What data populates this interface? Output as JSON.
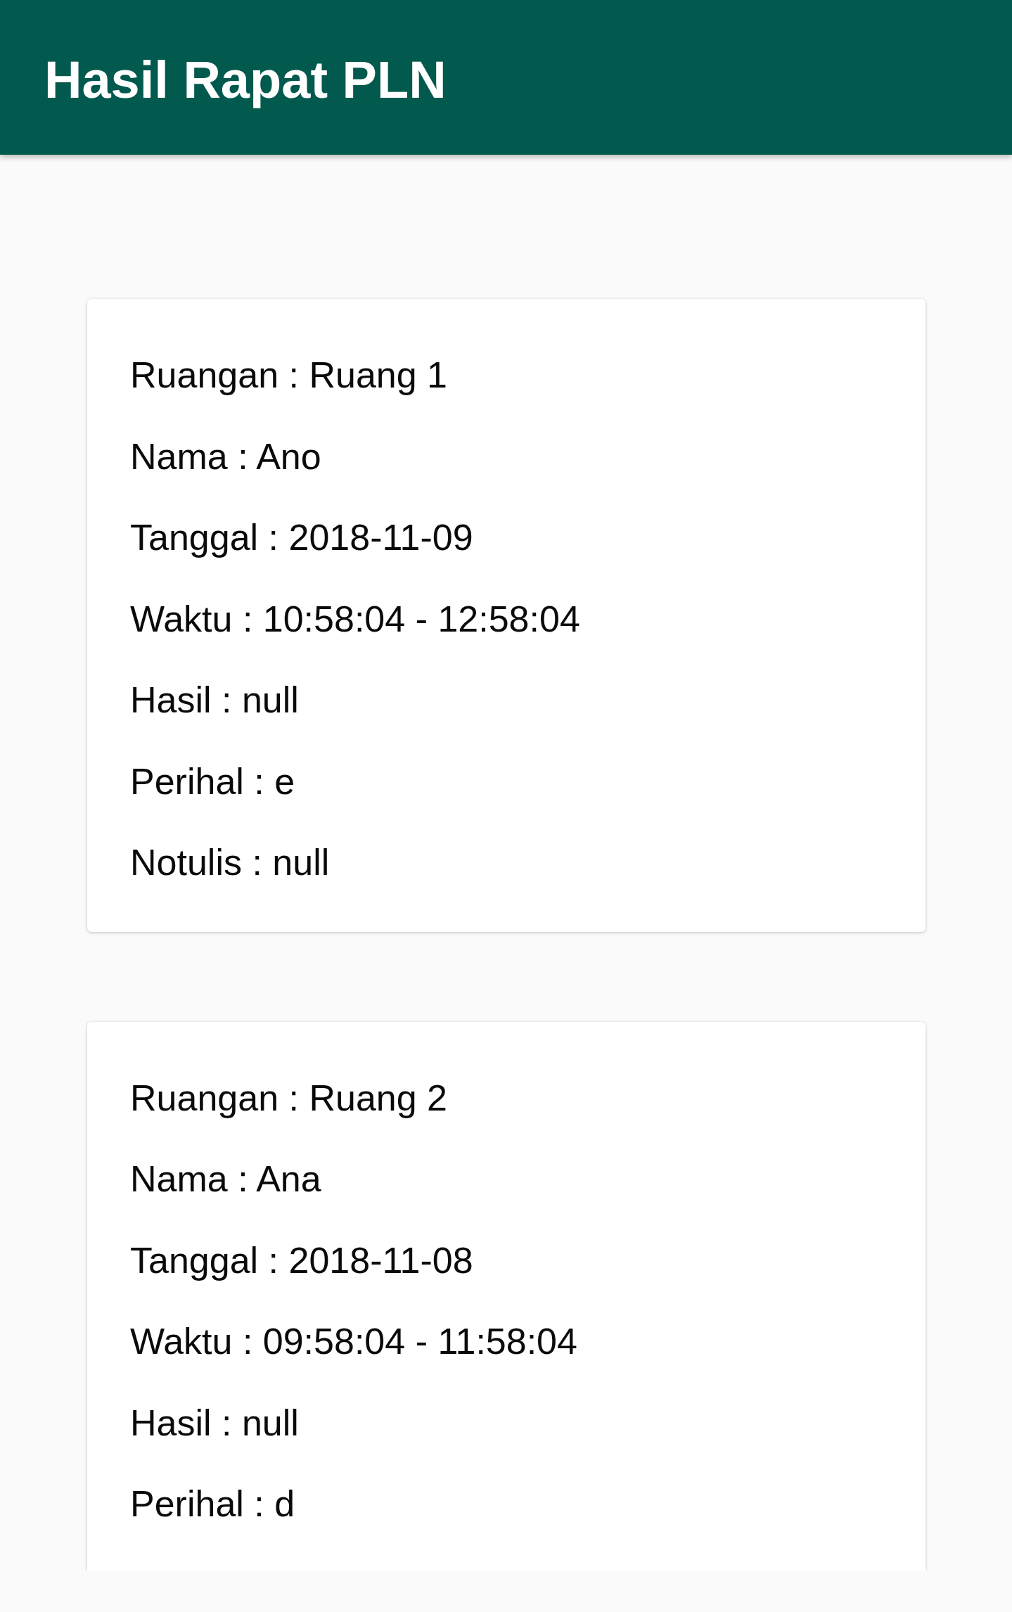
{
  "app_bar": {
    "title": "Hasil Rapat PLN"
  },
  "meetings": [
    {
      "lines": [
        "Ruangan : Ruang 1",
        "Nama : Ano",
        "Tanggal : 2018-11-09",
        "Waktu : 10:58:04 - 12:58:04",
        "Hasil : null",
        "Perihal : e",
        "Notulis : null"
      ]
    },
    {
      "lines": [
        "Ruangan : Ruang 2",
        "Nama : Ana",
        "Tanggal : 2018-11-08",
        "Waktu : 09:58:04 - 11:58:04",
        "Hasil : null",
        "Perihal : d"
      ]
    }
  ]
}
